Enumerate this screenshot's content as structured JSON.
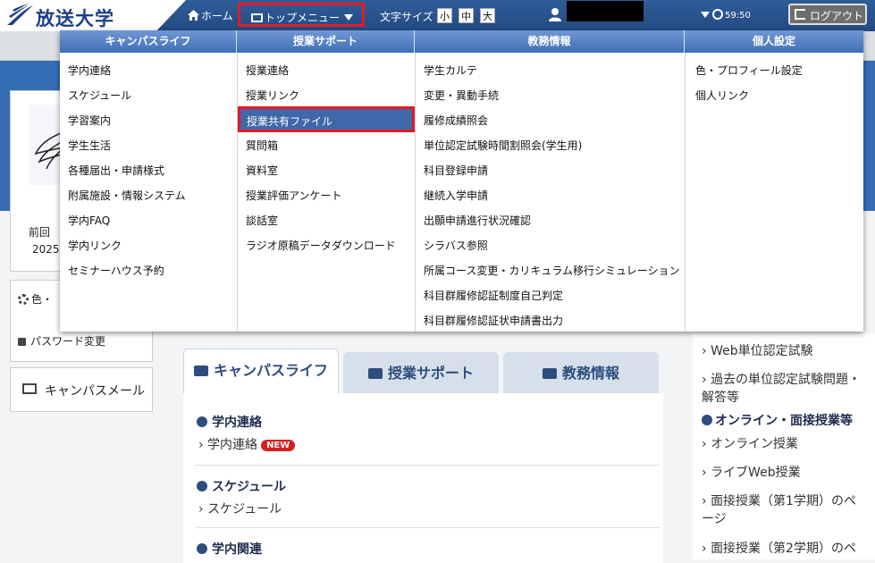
{
  "header": {
    "logo_text": "放送大学",
    "home_label": "ホーム",
    "topmenu_label": "トップメニュー",
    "fontsize_label": "文字サイズ",
    "fontsize_options": [
      "小",
      "中",
      "大"
    ],
    "timer": "59:50",
    "logout_label": "ログアウト"
  },
  "profile": {
    "last_login_label": "前回",
    "last_login_year": "2025"
  },
  "sidebar": {
    "color_label": "色・",
    "password_label": "パスワード変更",
    "mail_label": "キャンパスメール"
  },
  "tabs": [
    {
      "label": "キャンパスライフ"
    },
    {
      "label": "授業サポート"
    },
    {
      "label": "教務情報"
    }
  ],
  "sections": [
    {
      "heading": "学内連絡",
      "link": "学内連絡",
      "badge": "NEW"
    },
    {
      "heading": "スケジュール",
      "link": "スケジュール"
    },
    {
      "heading": "学内関連"
    }
  ],
  "right_panel": {
    "items": [
      "Web単位認定試験",
      "過去の単位認定試験問題・解答等",
      "オンライン・面接授業等",
      "オンライン授業",
      "ライブWeb授業",
      "面接授業（第1学期）のページ",
      "面接授業（第2学期）のペ"
    ]
  },
  "mega_menu": {
    "columns": [
      {
        "heading": "キャンパスライフ",
        "items": [
          "学内連絡",
          "スケジュール",
          "学習案内",
          "学生生活",
          "各種届出・申請様式",
          "附属施設・情報システム",
          "学内FAQ",
          "学内リンク",
          "セミナーハウス予約"
        ]
      },
      {
        "heading": "授業サポート",
        "items": [
          "授業連絡",
          "授業リンク",
          "授業共有ファイル",
          "質問箱",
          "資料室",
          "授業評価アンケート",
          "談話室",
          "ラジオ原稿データダウンロード"
        ]
      },
      {
        "heading": "教務情報",
        "items": [
          "学生カルテ",
          "変更・異動手続",
          "履修成績照会",
          "単位認定試験時間割照会(学生用)",
          "科目登録申請",
          "継続入学申請",
          "出願申請進行状況確認",
          "シラバス参照",
          "所属コース変更・カリキュラム移行シミュレーション",
          "科目群履修認証制度自己判定",
          "科目群履修認証状申請書出力"
        ]
      },
      {
        "heading": "個人設定",
        "items": [
          "色・プロフィール設定",
          "個人リンク"
        ]
      }
    ]
  }
}
